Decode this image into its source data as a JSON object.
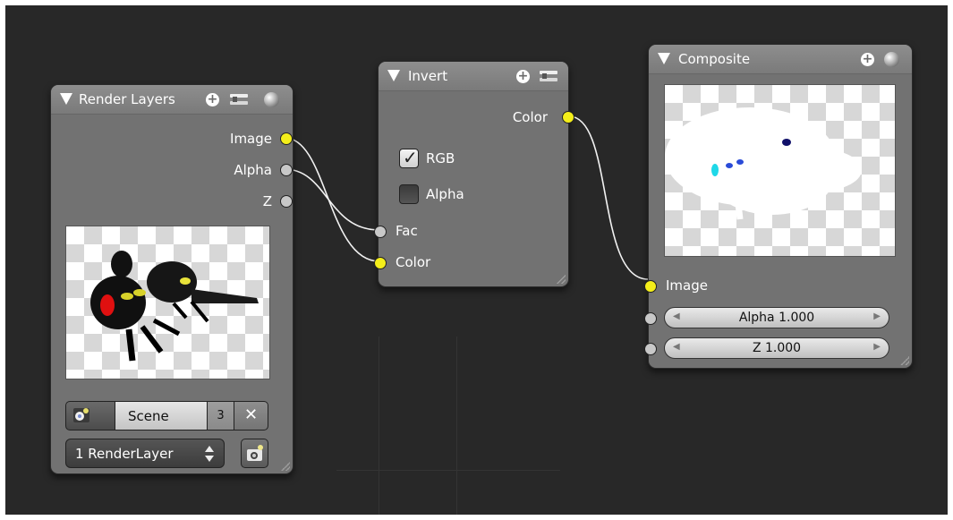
{
  "colors": {
    "editor_bg": "#282828",
    "node_bg": "#727272",
    "socket_color": "#f4ee1a",
    "socket_gray": "#c8c8c8",
    "wire": "#f0f0f0"
  },
  "render_layers": {
    "title": "Render Layers",
    "outputs": {
      "image": "Image",
      "alpha": "Alpha",
      "z": "Z"
    },
    "scene_field": "Scene",
    "scene_users": "3",
    "renderlayer_select": "1 RenderLayer",
    "icons": [
      "scene-icon",
      "remove-icon",
      "updown-arrows-icon",
      "render-icon"
    ]
  },
  "invert": {
    "title": "Invert",
    "output_color": "Color",
    "rgb_label": "RGB",
    "rgb_checked": true,
    "alpha_label": "Alpha",
    "alpha_checked": false,
    "inputs": {
      "fac": "Fac",
      "color": "Color"
    }
  },
  "composite": {
    "title": "Composite",
    "input_image": "Image",
    "alpha_field": "Alpha 1.000",
    "z_field": "Z 1.000"
  }
}
